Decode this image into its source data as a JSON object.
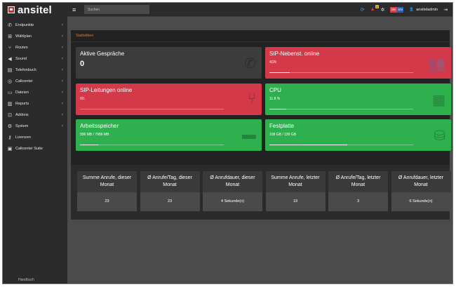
{
  "app": {
    "logo": "ansitel"
  },
  "sidebar": {
    "items": [
      {
        "label": "Endpunkte",
        "icon": "phone-icon",
        "glyph": "✆",
        "chevron": true
      },
      {
        "label": "Wählplan",
        "icon": "sitemap-icon",
        "glyph": "⊞",
        "chevron": true
      },
      {
        "label": "Routen",
        "icon": "route-icon",
        "glyph": "⑂",
        "chevron": true
      },
      {
        "label": "Sound",
        "icon": "speaker-icon",
        "glyph": "◀",
        "chevron": true
      },
      {
        "label": "Telefonbuch",
        "icon": "book-icon",
        "glyph": "▤",
        "chevron": true
      },
      {
        "label": "Callcenter",
        "icon": "headset-icon",
        "glyph": "◎",
        "chevron": true
      },
      {
        "label": "Dateien",
        "icon": "folder-icon",
        "glyph": "▭",
        "chevron": true
      },
      {
        "label": "Reports",
        "icon": "chart-icon",
        "glyph": "▥",
        "chevron": true
      },
      {
        "label": "Addons",
        "icon": "addon-icon",
        "glyph": "⊡",
        "chevron": true
      },
      {
        "label": "System",
        "icon": "gears-icon",
        "glyph": "⚙",
        "chevron": true
      },
      {
        "label": "Lizenzen",
        "icon": "key-icon",
        "glyph": "⚷",
        "chevron": false
      },
      {
        "label": "Callcenter Suite",
        "icon": "suite-icon",
        "glyph": "▣",
        "chevron": false
      }
    ],
    "footer": "Handbuch"
  },
  "topbar": {
    "search_placeholder": "Suchen",
    "alert_badge": "1",
    "flag_de": "DE",
    "flag_en": "EN",
    "username": "ansiteladmin"
  },
  "statistics": {
    "title": "Statistiken",
    "cards": [
      {
        "title": "Aktive Gespräche",
        "value": "0",
        "icon": "phone-volume-icon",
        "color": "#3c3c3c",
        "progress": null
      },
      {
        "title": "SIP-Nebenst. online",
        "value": "4/29",
        "icon": "users-icon",
        "color": "#d4394a",
        "progress": 0.14
      },
      {
        "title": "SIP-Leitungen online",
        "value": "0/1",
        "icon": "branch-icon",
        "color": "#d4394a",
        "progress": 0.0
      },
      {
        "title": "CPU",
        "value": "11.8 %",
        "icon": "microchip-icon",
        "color": "#2fb04f",
        "progress": 0.118
      },
      {
        "title": "Arbeitsspeicher",
        "value": "996 MB / 7986 MB",
        "icon": "memory-icon",
        "color": "#2fb04f",
        "progress": 0.125
      },
      {
        "title": "Festplatte",
        "value": "108 GB / 199 GB",
        "icon": "database-icon",
        "color": "#2fb04f",
        "progress": 0.54
      }
    ]
  },
  "summary": [
    {
      "label": "Summe Anrufe, dieser Monat",
      "value": "23"
    },
    {
      "label": "Ø Anrufe/Tag, dieser Monat",
      "value": "23"
    },
    {
      "label": "Ø Anrufdauer, dieser Monat",
      "value": "4 Sekunde(n)"
    },
    {
      "label": "Summe Anrufe, letzter Monat",
      "value": "19"
    },
    {
      "label": "Ø Anrufe/Tag, letzter Monat",
      "value": "3"
    },
    {
      "label": "Ø Anrufdauer, letzter Monat",
      "value": "6 Sekunde(n)"
    }
  ]
}
